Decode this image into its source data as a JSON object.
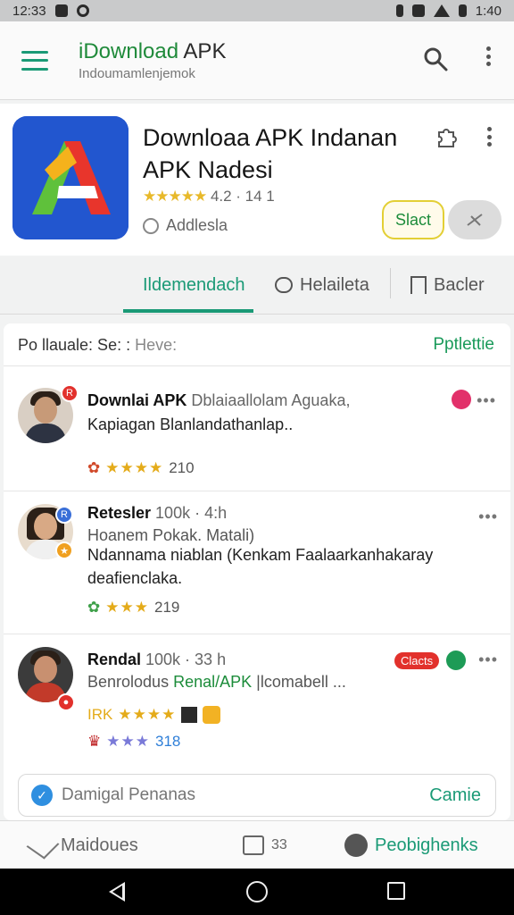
{
  "status_bar": {
    "time": "12:33",
    "clock_right": "1:40"
  },
  "app_bar": {
    "title_green": "iDownload",
    "title_dark": " APK",
    "subtitle": "Indoumamlenjemok"
  },
  "app_header": {
    "name_line1": "Downloaa APK Indanan",
    "name_line2": "APK Nadesi",
    "stars": "★★★★★",
    "rating_text": "4.2 · 14 1",
    "sub_label": "Addlesla",
    "start_label": "Slact"
  },
  "tabs": [
    {
      "label": "Ildemendach",
      "active": true
    },
    {
      "label": "Helaileta",
      "active": false
    },
    {
      "label": "Bacler",
      "active": false
    }
  ],
  "reviews_header": {
    "title": "Po llauale: Se: :",
    "title_muted": " Heve:",
    "action": "Pptlettie"
  },
  "reviews": [
    {
      "name": "Downlai APK",
      "name_meta": " Dblaiaallolam Aguaka,",
      "text": "Kapiagan Blanlandathanlap..",
      "text_muted": "",
      "stars": "★★★★",
      "count": "210"
    },
    {
      "name": "Retesler",
      "name_meta": " 100k · 4:h",
      "text_muted": "Hoanem Pokak. Matali)",
      "text": "Ndannama niablan (Kenkam Faalaarkanhakaray deafienclaka.",
      "stars": "★★★",
      "count": "219"
    },
    {
      "name": "Rendal",
      "name_meta": " 100k · 33 h",
      "text_pre": "Benrolodus ",
      "text_green": "Renal/APK",
      "text_post": " |lcomabell ...",
      "chip": "Clacts",
      "stars_prefix": "IRK",
      "stars": "★★★★",
      "stars_row2": "★★★",
      "count": "318"
    }
  ],
  "reply_box": {
    "placeholder": "Damigal Penanas",
    "send_label": "Camie"
  },
  "bottom_nav": [
    {
      "label": "Maidoues",
      "active": false
    },
    {
      "label": "33",
      "active": false
    },
    {
      "label": "Peobighenks",
      "active": true
    }
  ],
  "colors": {
    "accent": "#1a9a76",
    "green_text": "#1c8c3a",
    "star": "#e4ab1a",
    "badge_red": "#e2312c"
  }
}
